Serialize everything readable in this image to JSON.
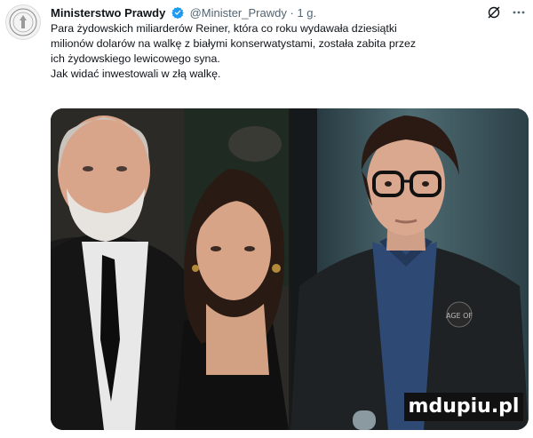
{
  "tweet": {
    "author_name": "Ministerstwo Prawdy",
    "handle": "@Minister_Prawdy",
    "separator": "·",
    "time": "1 g.",
    "text_lines": [
      "Para żydowskich miliarderów Reiner, która co roku wydawała dziesiątki",
      "milionów dolarów na walkę z białymi konserwatystami, została zabita przez",
      "ich żydowskiego lewicowego syna.",
      "Jak widać inwestowali w złą walkę."
    ]
  },
  "icons": {
    "avatar": "ministry-seal-icon",
    "verified": "verified-badge-icon",
    "grok": "grok-icon",
    "more": "more-options-icon"
  },
  "media": {
    "photo_right_badge": "AGE OF"
  },
  "watermark": {
    "text": "mdupiu.pl"
  },
  "colors": {
    "verified": "#1d9bf0",
    "text": "#0f1419",
    "secondary": "#536471"
  }
}
